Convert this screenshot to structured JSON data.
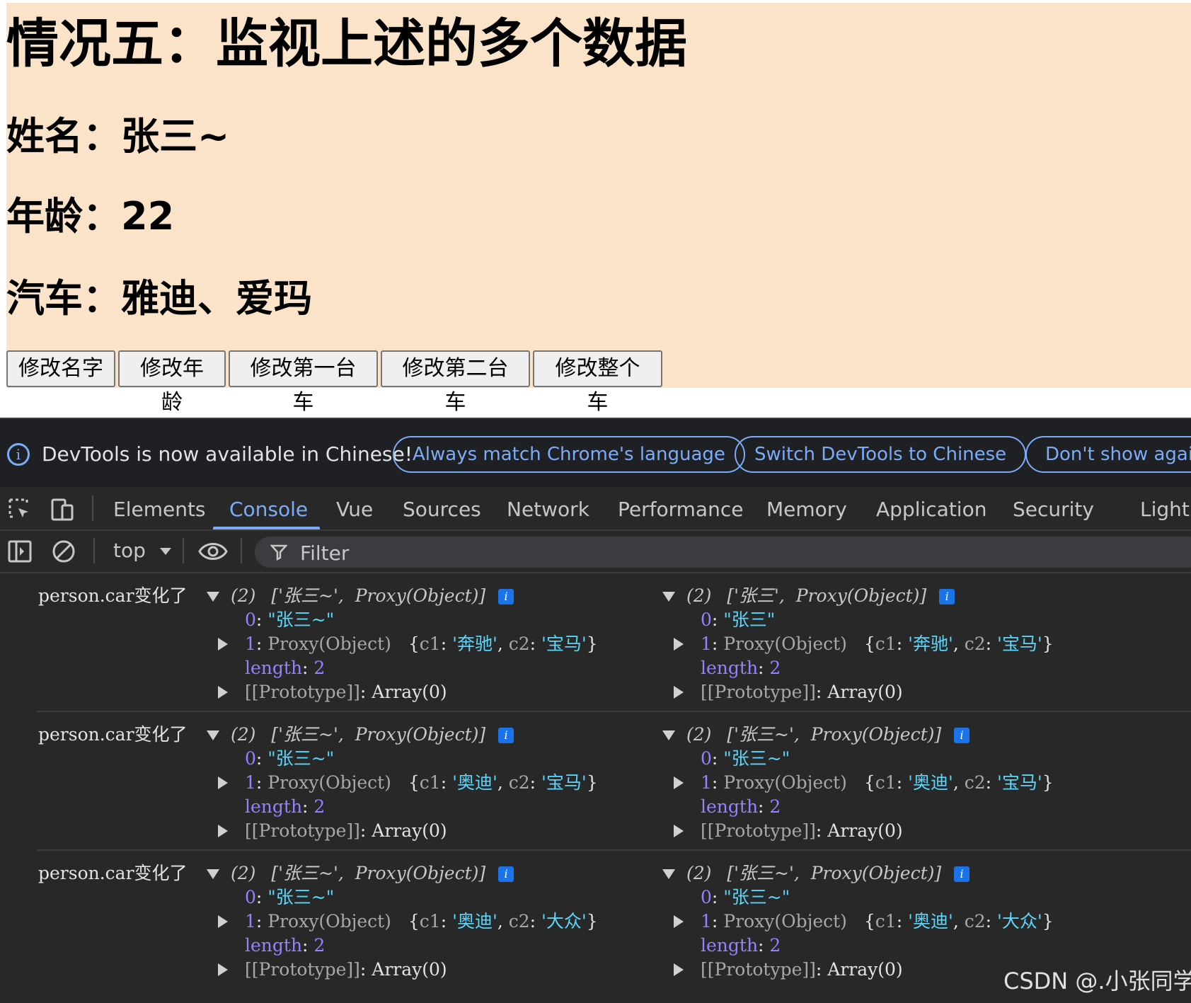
{
  "page": {
    "title": "情况五：监视上述的多个数据",
    "name_line": "姓名：张三~",
    "age_line": "年龄：22",
    "car_line": "汽车：雅迪、爱玛",
    "buttons": [
      "修改名字",
      "修改年龄",
      "修改第一台车",
      "修改第二台车",
      "修改整个车"
    ],
    "background": "#fae3c8"
  },
  "devtools": {
    "infobar": {
      "message": "DevTools is now available in Chinese!",
      "actions": [
        "Always match Chrome's language",
        "Switch DevTools to Chinese",
        "Don't show again"
      ]
    },
    "tabs": [
      "Elements",
      "Console",
      "Vue",
      "Sources",
      "Network",
      "Performance",
      "Memory",
      "Application",
      "Security",
      "Lighth"
    ],
    "active_tab": "Console",
    "toolbar": {
      "context": "top",
      "filter_placeholder": "Filter"
    },
    "accent": "#7cacf8",
    "console_messages": [
      {
        "label": "person.car变化了",
        "new": {
          "summary_open": "(2)",
          "summary_a": "['张三~',",
          "summary_b": "Proxy(Object)]",
          "item0_value": "\"张三~\"",
          "c1": "'奔驰'",
          "c2": "'宝马'",
          "length": "2"
        },
        "old": {
          "summary_open": "(2)",
          "summary_a": "['张三',",
          "summary_b": "Proxy(Object)]",
          "item0_value": "\"张三\"",
          "c1": "'奔驰'",
          "c2": "'宝马'",
          "length": "2"
        }
      },
      {
        "label": "person.car变化了",
        "new": {
          "summary_open": "(2)",
          "summary_a": "['张三~',",
          "summary_b": "Proxy(Object)]",
          "item0_value": "\"张三~\"",
          "c1": "'奥迪'",
          "c2": "'宝马'",
          "length": "2"
        },
        "old": {
          "summary_open": "(2)",
          "summary_a": "['张三~',",
          "summary_b": "Proxy(Object)]",
          "item0_value": "\"张三~\"",
          "c1": "'奥迪'",
          "c2": "'宝马'",
          "length": "2"
        }
      },
      {
        "label": "person.car变化了",
        "new": {
          "summary_open": "(2)",
          "summary_a": "['张三~',",
          "summary_b": "Proxy(Object)]",
          "item0_value": "\"张三~\"",
          "c1": "'奥迪'",
          "c2": "'大众'",
          "length": "2"
        },
        "old": {
          "summary_open": "(2)",
          "summary_a": "['张三~',",
          "summary_b": "Proxy(Object)]",
          "item0_value": "\"张三~\"",
          "c1": "'奥迪'",
          "c2": "'大众'",
          "length": "2"
        }
      }
    ],
    "labels": {
      "item0_key": "0",
      "item1_key": "1",
      "proxy_label": "Proxy(Object)",
      "c1_key": "c1",
      "c2_key": "c2",
      "length_key": "length",
      "prototype_key": "[[Prototype]]",
      "prototype_value": "Array(0)",
      "info_badge": "i"
    }
  },
  "watermark": "CSDN @.小张同学"
}
